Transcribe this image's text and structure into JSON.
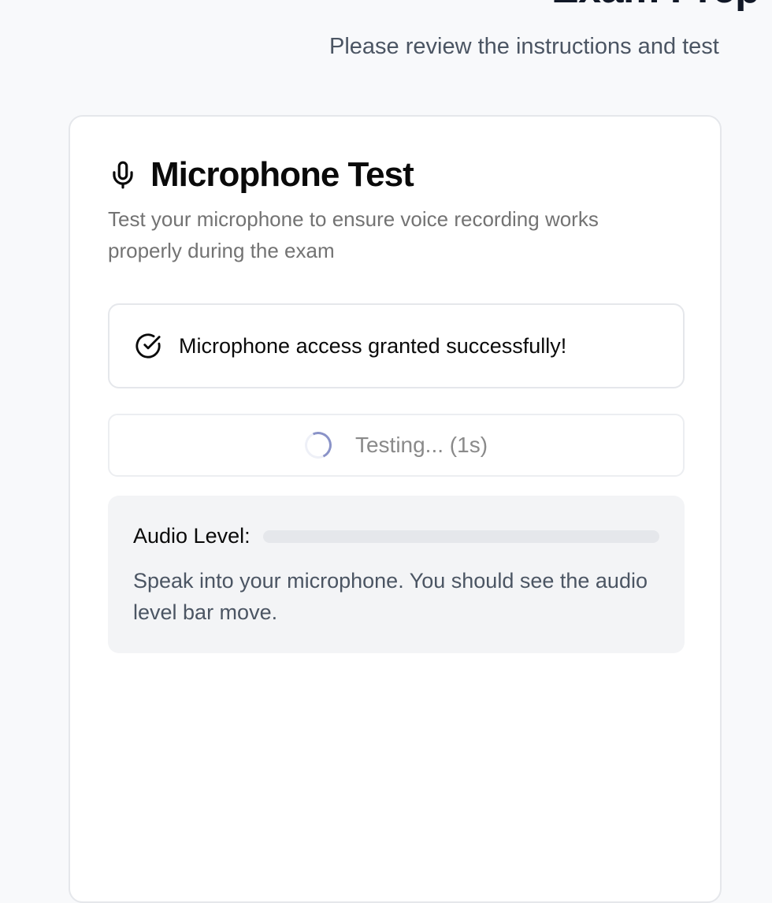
{
  "header": {
    "title": "Exam Prep",
    "subtitle": "Please review the instructions and test"
  },
  "mic_test": {
    "title": "Microphone Test",
    "description": "Test your microphone to ensure voice recording works properly during the exam",
    "status_message": "Microphone access granted successfully!",
    "test_button_label": "Testing... (1s)",
    "audio_level_label": "Audio Level:",
    "audio_level_value": 0,
    "hint": "Speak into your microphone. You should see the audio level bar move."
  },
  "icons": {
    "title_icon": "microphone-icon",
    "status_icon": "check-circle-icon",
    "button_icon": "loading-spinner-icon"
  },
  "colors": {
    "background": "#f8f9fb",
    "card": "#ffffff",
    "spinner_accent": "#8a93c8",
    "level_track": "#e5e7eb"
  }
}
